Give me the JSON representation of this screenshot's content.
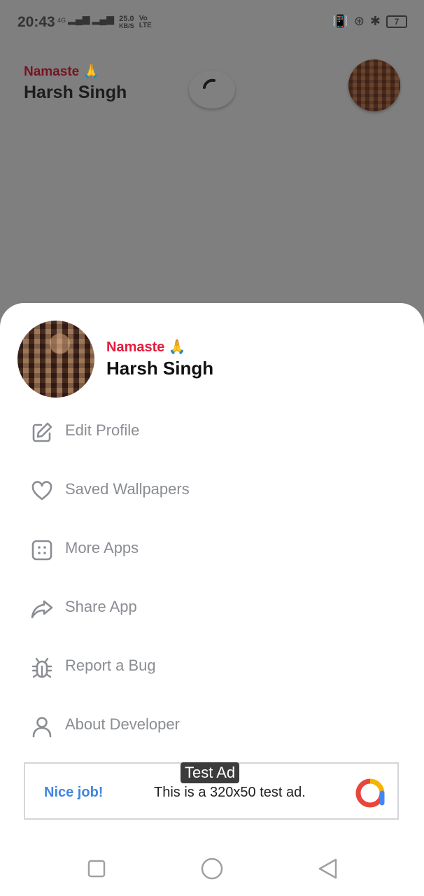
{
  "status_bar": {
    "time": "20:43",
    "network_left": "4G",
    "speed_value": "25.0",
    "speed_unit": "KB/S",
    "volte": "Vo LTE",
    "battery": "7"
  },
  "background": {
    "greeting": "Namaste 🙏",
    "name": "Harsh Singh"
  },
  "sheet": {
    "greeting": "Namaste 🙏",
    "name": "Harsh Singh",
    "menu": [
      {
        "label": "Edit Profile",
        "icon": "edit-icon"
      },
      {
        "label": "Saved Wallpapers",
        "icon": "heart-icon"
      },
      {
        "label": "More Apps",
        "icon": "apps-icon"
      },
      {
        "label": "Share App",
        "icon": "share-icon"
      },
      {
        "label": "Report a Bug",
        "icon": "bug-icon"
      },
      {
        "label": "About Developer",
        "icon": "user-icon"
      }
    ]
  },
  "ad": {
    "badge": "Test Ad",
    "nice": "Nice job!",
    "text": "This is a 320x50 test ad."
  },
  "colors": {
    "greeting_red": "#e31b3c",
    "menu_text": "#8a8d93",
    "ad_blue": "#3f86e0"
  }
}
